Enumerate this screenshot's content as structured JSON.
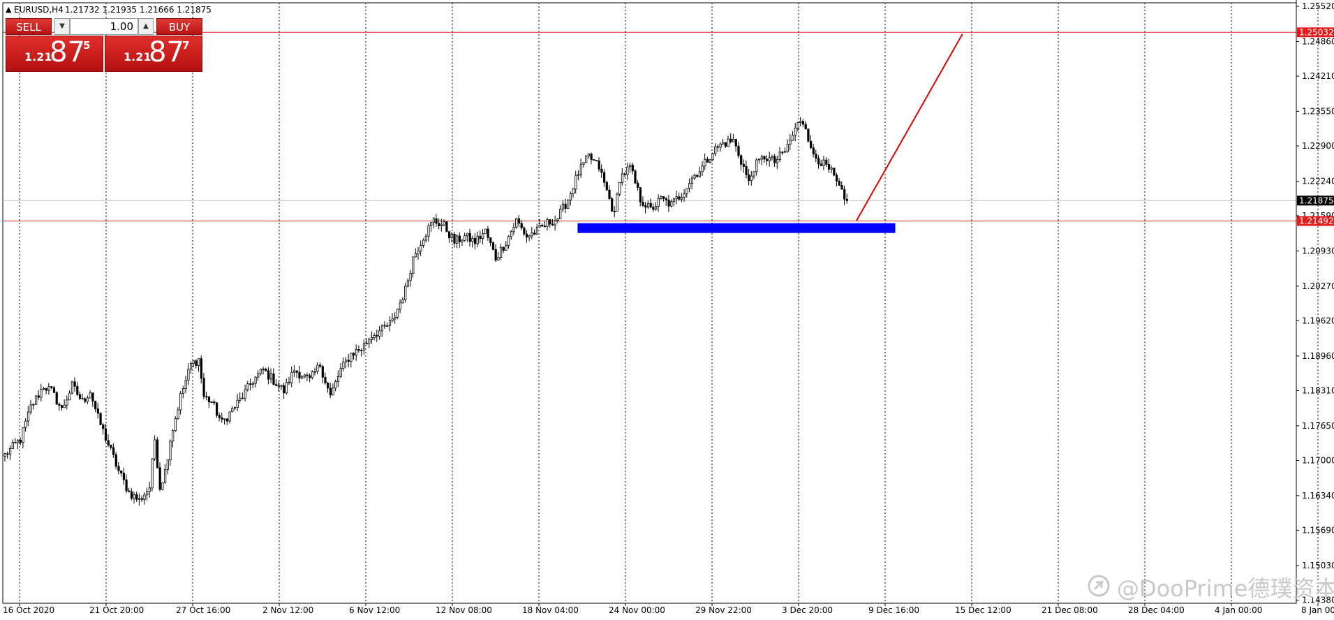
{
  "header": {
    "symbol": "EURUSD,H4",
    "ohlc": "1.21732 1.21935 1.21666 1.21875"
  },
  "trade_panel": {
    "sell_label": "SELL",
    "buy_label": "BUY",
    "lot_value": "1.00",
    "sell_quote": {
      "big_figure": "1.21",
      "pips": "87",
      "point": "5"
    },
    "buy_quote": {
      "big_figure": "1.21",
      "pips": "87",
      "point": "7"
    }
  },
  "watermark": "@DooPrime德璞资本",
  "colors": {
    "candle": "#000000",
    "grid": "#000000",
    "horizontal_line": "#d42a2a",
    "current_price_line": "#c0c0c0",
    "zone": "#0000ff",
    "trend_line": "#e00000",
    "price_label_red_bg": "#e31d1d",
    "price_label_black_bg": "#000000"
  },
  "chart_data": {
    "type": "candlestick",
    "symbol": "EURUSD",
    "timeframe": "H4",
    "y_axis": {
      "min": 1.144,
      "max": 1.2555,
      "tick_labels": [
        "1.25520",
        "1.24860",
        "1.24210",
        "1.23550",
        "1.22900",
        "1.22240",
        "1.21590",
        "1.20930",
        "1.20270",
        "1.19620",
        "1.18960",
        "1.18310",
        "1.17650",
        "1.17000",
        "1.16340",
        "1.15690",
        "1.15030",
        "1.14380"
      ]
    },
    "x_axis": {
      "tick_labels": [
        "16 Oct 2020",
        "21 Oct 20:00",
        "27 Oct 16:00",
        "2 Nov 12:00",
        "6 Nov 12:00",
        "12 Nov 08:00",
        "18 Nov 04:00",
        "24 Nov 00:00",
        "29 Nov 22:00",
        "3 Dec 20:00",
        "9 Dec 16:00",
        "15 Dec 12:00",
        "21 Dec 08:00",
        "28 Dec 04:00",
        "4 Jan 00:00",
        "8 Jan 00:00"
      ]
    },
    "price_path": [
      [
        0,
        1.171
      ],
      [
        6,
        1.174
      ],
      [
        10,
        1.18
      ],
      [
        15,
        1.184
      ],
      [
        18,
        1.183
      ],
      [
        22,
        1.1795
      ],
      [
        26,
        1.184
      ],
      [
        30,
        1.181
      ],
      [
        33,
        1.183
      ],
      [
        36,
        1.178
      ],
      [
        40,
        1.173
      ],
      [
        44,
        1.168
      ],
      [
        48,
        1.164
      ],
      [
        52,
        1.1625
      ],
      [
        56,
        1.165
      ],
      [
        58,
        1.174
      ],
      [
        60,
        1.165
      ],
      [
        62,
        1.168
      ],
      [
        64,
        1.174
      ],
      [
        68,
        1.182
      ],
      [
        72,
        1.188
      ],
      [
        75,
        1.189
      ],
      [
        77,
        1.182
      ],
      [
        80,
        1.181
      ],
      [
        84,
        1.177
      ],
      [
        88,
        1.1795
      ],
      [
        92,
        1.182
      ],
      [
        96,
        1.185
      ],
      [
        100,
        1.187
      ],
      [
        104,
        1.185
      ],
      [
        108,
        1.183
      ],
      [
        112,
        1.187
      ],
      [
        118,
        1.185
      ],
      [
        122,
        1.188
      ],
      [
        126,
        1.182
      ],
      [
        130,
        1.187
      ],
      [
        134,
        1.19
      ],
      [
        138,
        1.191
      ],
      [
        142,
        1.1935
      ],
      [
        146,
        1.1945
      ],
      [
        150,
        1.196
      ],
      [
        155,
        1.202
      ],
      [
        158,
        1.208
      ],
      [
        162,
        1.212
      ],
      [
        166,
        1.215
      ],
      [
        170,
        1.214
      ],
      [
        174,
        1.211
      ],
      [
        178,
        1.212
      ],
      [
        182,
        1.211
      ],
      [
        186,
        1.213
      ],
      [
        190,
        1.208
      ],
      [
        194,
        1.211
      ],
      [
        198,
        1.215
      ],
      [
        202,
        1.212
      ],
      [
        206,
        1.213
      ],
      [
        210,
        1.2145
      ],
      [
        214,
        1.2155
      ],
      [
        218,
        1.219
      ],
      [
        222,
        1.224
      ],
      [
        226,
        1.227
      ],
      [
        230,
        1.225
      ],
      [
        234,
        1.219
      ],
      [
        236,
        1.216
      ],
      [
        238,
        1.223
      ],
      [
        242,
        1.225
      ],
      [
        246,
        1.219
      ],
      [
        250,
        1.217
      ],
      [
        254,
        1.219
      ],
      [
        258,
        1.218
      ],
      [
        262,
        1.22
      ],
      [
        266,
        1.223
      ],
      [
        270,
        1.225
      ],
      [
        274,
        1.228
      ],
      [
        278,
        1.2295
      ],
      [
        282,
        1.23
      ],
      [
        286,
        1.225
      ],
      [
        288,
        1.222
      ],
      [
        290,
        1.225
      ],
      [
        294,
        1.227
      ],
      [
        298,
        1.226
      ],
      [
        302,
        1.228
      ],
      [
        306,
        1.232
      ],
      [
        308,
        1.234
      ],
      [
        310,
        1.233
      ],
      [
        312,
        1.228
      ],
      [
        316,
        1.226
      ],
      [
        320,
        1.224
      ],
      [
        324,
        1.22
      ],
      [
        326,
        1.2175
      ]
    ],
    "horizontal_lines": [
      {
        "price": 1.25032,
        "label": "1.25032",
        "color": "#d42a2a"
      },
      {
        "price": 1.21492,
        "label": "1.21492",
        "color": "#d42a2a"
      }
    ],
    "current_price": {
      "price": 1.21875,
      "label": "1.21875"
    },
    "zone": {
      "price_top": 1.2149,
      "price_bottom": 1.2135,
      "from_bar": 222,
      "to_bar": 345
    },
    "trend_line": {
      "from": [
        330,
        1.215
      ],
      "to": [
        371,
        1.25
      ]
    }
  }
}
